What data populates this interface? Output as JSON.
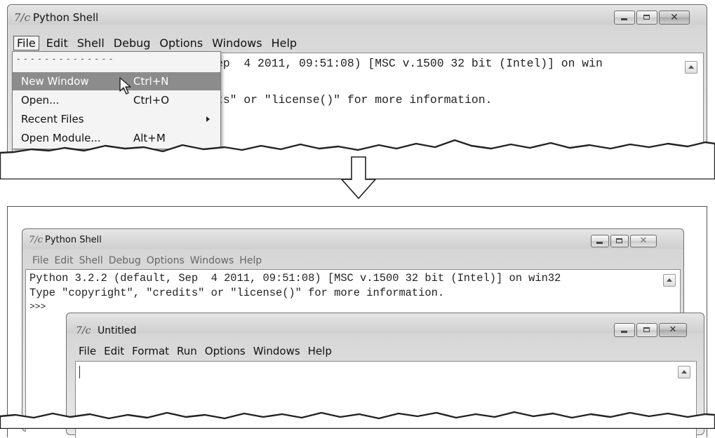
{
  "top": {
    "window_title": "Python Shell",
    "menu": [
      "File",
      "Edit",
      "Shell",
      "Debug",
      "Options",
      "Windows",
      "Help"
    ],
    "shell_line1": "ep  4 2011, 09:51:08) [MSC v.1500 32 bit (Intel)] on win",
    "shell_line2": "ts\" or \"license()\" for more information.",
    "dropdown": {
      "separator": "- - - - - - - - - - - - - -",
      "items": [
        {
          "label": "New Window",
          "shortcut": "Ctrl+N",
          "highlighted": true
        },
        {
          "label": "Open...",
          "shortcut": "Ctrl+O"
        },
        {
          "label": "Recent Files",
          "shortcut": "",
          "submenu": true
        },
        {
          "label": "Open Module...",
          "shortcut": "Alt+M"
        }
      ]
    }
  },
  "bottom": {
    "shell": {
      "window_title": "Python Shell",
      "menu": [
        "File",
        "Edit",
        "Shell",
        "Debug",
        "Options",
        "Windows",
        "Help"
      ],
      "lines": [
        "Python 3.2.2 (default, Sep  4 2011, 09:51:08) [MSC v.1500 32 bit (Intel)] on win32",
        "Type \"copyright\", \"credits\" or \"license()\" for more information.",
        ">>>"
      ]
    },
    "editor": {
      "window_title": "Untitled",
      "menu": [
        "File",
        "Edit",
        "Format",
        "Run",
        "Options",
        "Windows",
        "Help"
      ]
    }
  },
  "icons": {
    "app_icon": "tk-feather-icon",
    "arrow": "down-arrow-icon",
    "cursor": "mouse-pointer-icon"
  },
  "colors": {
    "highlight": "#8c8c8c",
    "text": "#222222"
  }
}
